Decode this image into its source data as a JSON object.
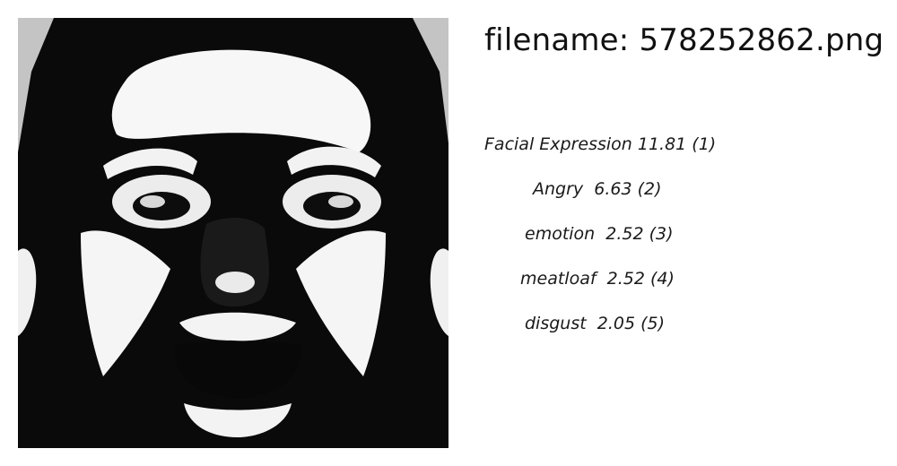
{
  "image": {
    "alt": "face-image"
  },
  "header": {
    "filename": "filename: 578252862.png"
  },
  "labels": [
    {
      "text": "Facial Expression 11.81 (1)"
    },
    {
      "text": "Angry  6.63 (2)"
    },
    {
      "text": "emotion  2.52 (3)"
    },
    {
      "text": "meatloaf  2.52 (4)"
    },
    {
      "text": "disgust  2.05 (5)"
    }
  ]
}
